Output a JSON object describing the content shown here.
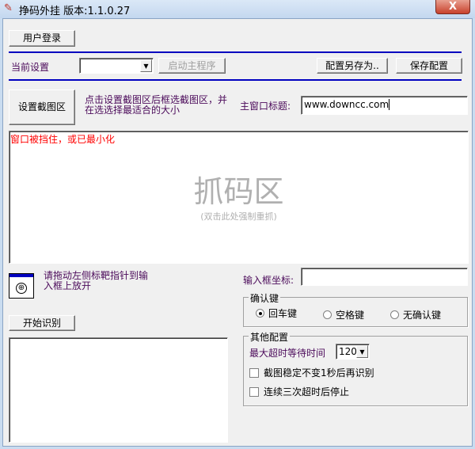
{
  "window": {
    "title": "挣码外挂 版本:1.1.0.27",
    "close_label": "X"
  },
  "toolbar": {
    "login": "用户登录",
    "current_settings_label": "当前设置",
    "current_settings_value": "",
    "start_main": "启动主程序",
    "save_as": "配置另存为..",
    "save": "保存配置"
  },
  "capture": {
    "set_region": "设置截图区",
    "hint": "点击设置截图区后框选截图区，并在选选择最适合的大小",
    "main_title_label": "主窗口标题:",
    "main_title_value": "www.downcc.com"
  },
  "preview": {
    "status": "窗口被挡住，或已最小化",
    "big_label": "抓码区",
    "sub_label": "(双击此处强制重抓)"
  },
  "target": {
    "hint": "请拖动左侧标靶指针到输入框上放开",
    "coord_label": "输入框坐标:",
    "coord_value": ""
  },
  "confirm": {
    "legend": "确认键",
    "options": [
      {
        "label": "回车键",
        "checked": true
      },
      {
        "label": "空格键",
        "checked": false
      },
      {
        "label": "无确认键",
        "checked": false
      }
    ]
  },
  "recognize": {
    "start": "开始识别",
    "output": ""
  },
  "other": {
    "legend": "其他配置",
    "timeout_label": "最大超时等待时间",
    "timeout_value": "120",
    "check1": "截图稳定不变1秒后再识别",
    "check2": "连续三次超时后停止"
  }
}
